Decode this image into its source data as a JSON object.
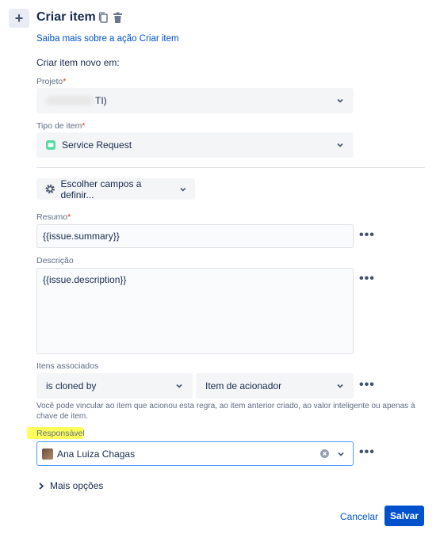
{
  "header": {
    "title": "Criar item",
    "learn_link": "Saiba mais sobre a ação Criar item"
  },
  "create_in_label": "Criar item novo em:",
  "project": {
    "label": "Projeto",
    "required_mark": "*",
    "value_suffix": "TI)"
  },
  "issue_type": {
    "label": "Tipo de item",
    "required_mark": "*",
    "value": "Service Request"
  },
  "fields_button": {
    "label": "Escolher campos a definir..."
  },
  "summary": {
    "label": "Resumo",
    "required_mark": "*",
    "value": "{{issue.summary}}"
  },
  "description": {
    "label": "Descrição",
    "value": "{{issue.description}}"
  },
  "linked_issues": {
    "label": "Itens associados",
    "link_type": "is cloned by",
    "target": "Item de acionador",
    "help": "Você pode vincular ao item que acionou esta regra, ao item anterior criado, ao valor inteligente ou apenas à chave de item."
  },
  "assignee": {
    "label": "Responsável",
    "value": "Ana Luiza Chagas"
  },
  "more_options": {
    "label": "Mais opções"
  },
  "footer": {
    "cancel": "Cancelar",
    "save": "Salvar"
  },
  "more_actions_glyph": "•••",
  "colors": {
    "primary": "#0052cc",
    "highlight": "#ffff5c",
    "focus_border": "#4c9aff"
  }
}
